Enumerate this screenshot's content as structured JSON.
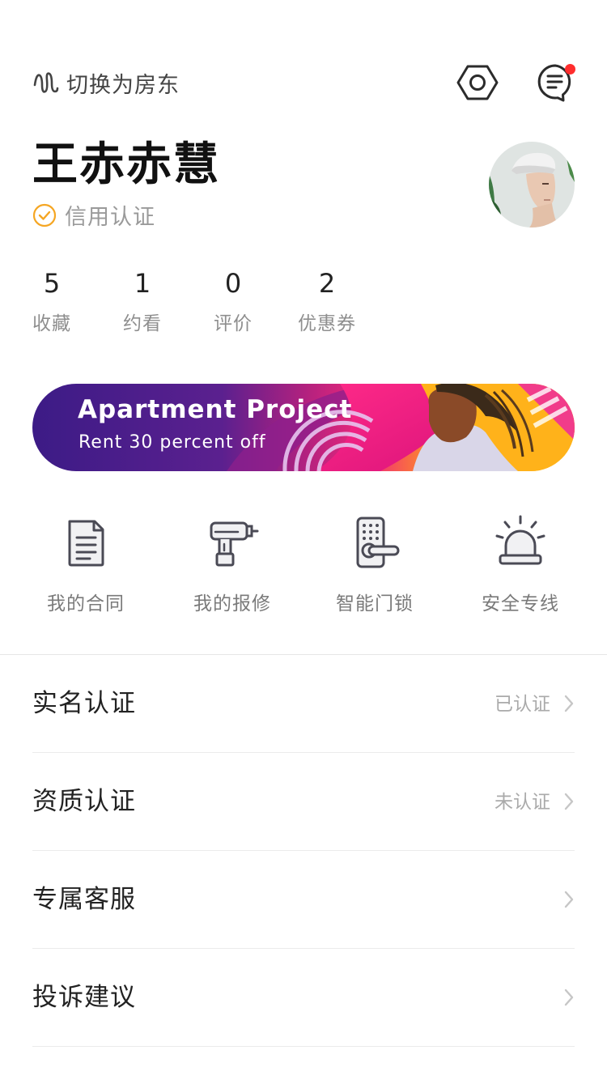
{
  "header": {
    "switch_label": "切换为房东",
    "settings_icon": "hexagon-settings-icon",
    "message_icon": "chat-bubble-icon",
    "has_unread": true
  },
  "profile": {
    "name": "王赤赤慧",
    "credit_label": "信用认证",
    "credit_icon": "check-circle-icon"
  },
  "stats": [
    {
      "value": "5",
      "label": "收藏"
    },
    {
      "value": "1",
      "label": "约看"
    },
    {
      "value": "0",
      "label": "评价"
    },
    {
      "value": "2",
      "label": "优惠券"
    }
  ],
  "banner": {
    "title": "Apartment Project",
    "subtitle": "Rent 30 percent off"
  },
  "services": [
    {
      "label": "我的合同",
      "icon": "contract-document-icon"
    },
    {
      "label": "我的报修",
      "icon": "drill-repair-icon"
    },
    {
      "label": "智能门锁",
      "icon": "smart-lock-icon"
    },
    {
      "label": "安全专线",
      "icon": "alarm-siren-icon"
    }
  ],
  "menu": [
    {
      "label": "实名认证",
      "status": "已认证"
    },
    {
      "label": "资质认证",
      "status": "未认证"
    },
    {
      "label": "专属客服",
      "status": ""
    },
    {
      "label": "投诉建议",
      "status": ""
    }
  ],
  "colors": {
    "accent_orange": "#f5a623",
    "notification_red": "#ff2d2d",
    "banner_purple": "#4a1f8c",
    "banner_pink": "#e8237a",
    "banner_yellow": "#ffc51a"
  }
}
